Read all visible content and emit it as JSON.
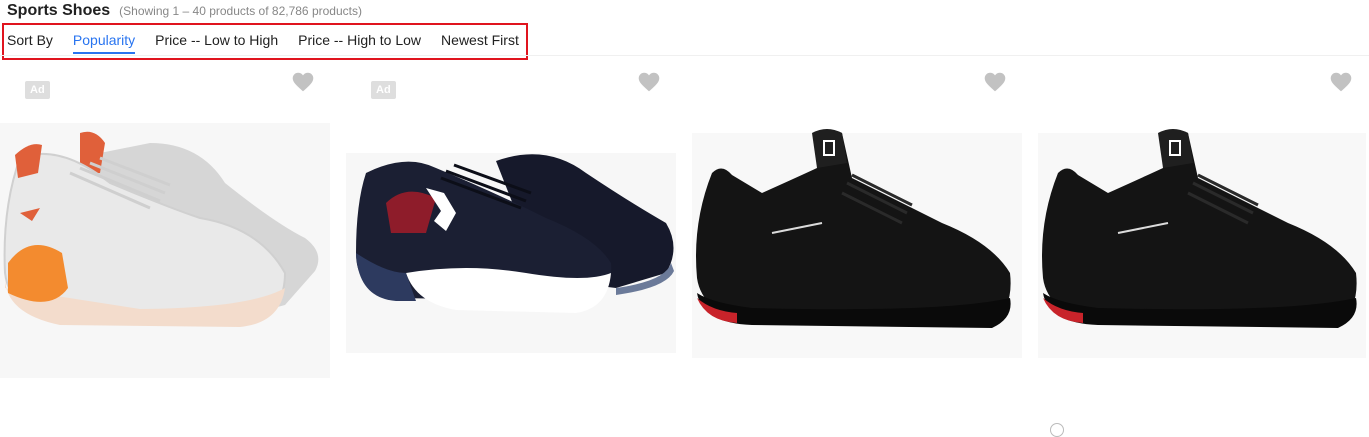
{
  "header": {
    "title": "Sports Shoes",
    "result_count": "(Showing 1 – 40 products of 82,786 products)"
  },
  "sort": {
    "label": "Sort By",
    "options": [
      "Popularity",
      "Price -- Low to High",
      "Price -- High to Low",
      "Newest First"
    ],
    "active": "Popularity"
  },
  "products": [
    {
      "ad_label": "Ad",
      "icon": "heart-icon",
      "image": "white-orange-running-shoe"
    },
    {
      "ad_label": "Ad",
      "icon": "heart-icon",
      "image": "navy-red-running-shoe"
    },
    {
      "icon": "heart-icon",
      "image": "black-knit-sneaker"
    },
    {
      "icon": "heart-icon",
      "image": "black-knit-sneaker"
    }
  ],
  "colors": {
    "accent": "#2874f0",
    "highlight_border": "#e0141e",
    "wishlist": "#c2c2c2",
    "ad_badge": "#dedede"
  }
}
